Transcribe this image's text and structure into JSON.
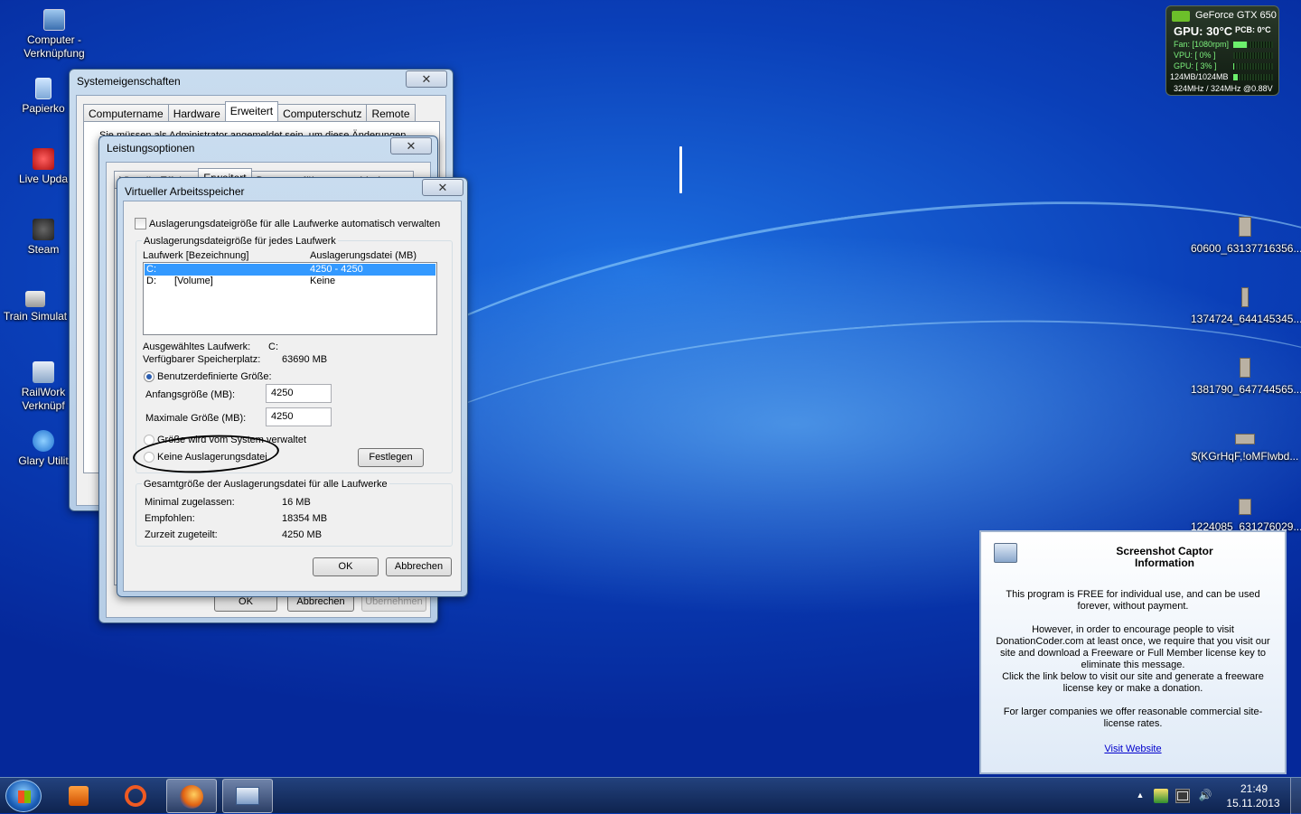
{
  "desktop": {
    "left_icons": [
      {
        "label": "Computer - Verknüpfung"
      },
      {
        "label": "Papierko"
      },
      {
        "label": "Live Upda"
      },
      {
        "label": "Steam"
      },
      {
        "label": "Train Simulat"
      },
      {
        "label": "RailWork Verknüpf"
      },
      {
        "label": "Glary Utilit"
      }
    ],
    "right_icons": [
      {
        "label": "60600_63137716356..."
      },
      {
        "label": "1374724_644145345..."
      },
      {
        "label": "1381790_647744565..."
      },
      {
        "label": "$(KGrHqF,!oMFlwbd..."
      },
      {
        "label": "1224085_631276029..."
      }
    ]
  },
  "gpu_gadget": {
    "title": "GeForce GTX 650",
    "gpu_temp": "GPU: 30°C",
    "pcb_temp": "PCB: 0°C",
    "fan": "Fan: [1080rpm]",
    "vpu": "VPU: [ 0% ]",
    "gpu_load": "GPU: [ 3% ]",
    "memory": "124MB/1024MB",
    "clocks": "324MHz / 324MHz @0.88V",
    "fan_level": 0.35,
    "vpu_level": 0.0,
    "gpu_level": 0.03,
    "mem_level": 0.12
  },
  "sysprops": {
    "title": "Systemeigenschaften",
    "close": "✕",
    "tabs": [
      "Computername",
      "Hardware",
      "Erweitert",
      "Computerschutz",
      "Remote"
    ],
    "selected_tab": "Erweitert",
    "text": "Sie müssen als Administrator angemeldet sein, um diese Änderungen"
  },
  "perfopts": {
    "title": "Leistungsoptionen",
    "close": "✕",
    "tabs": [
      "Visuelle Effekte",
      "Erweitert",
      "Datenausführungsverhinderung"
    ],
    "ok": "OK",
    "cancel": "Abbrechen",
    "apply": "Übernehmen"
  },
  "virtmem": {
    "title": "Virtueller Arbeitsspeicher",
    "close": "✕",
    "auto_manage_label": "Auslagerungsdateigröße für alle Laufwerke automatisch verwalten",
    "auto_manage_checked": false,
    "per_drive_group": "Auslagerungsdateigröße für jedes Laufwerk",
    "col_drive": "Laufwerk [Bezeichnung]",
    "col_pagefile": "Auslagerungsdatei (MB)",
    "drives": [
      {
        "drive": "C:",
        "label": "",
        "pagefile": "4250 - 4250",
        "selected": true
      },
      {
        "drive": "D:",
        "label": "[Volume]",
        "pagefile": "Keine",
        "selected": false
      }
    ],
    "selected_drive_label": "Ausgewähltes Laufwerk:",
    "selected_drive_value": "C:",
    "free_space_label": "Verfügbarer Speicherplatz:",
    "free_space_value": "63690 MB",
    "custom_size_label": "Benutzerdefinierte Größe:",
    "initial_size_label": "Anfangsgröße (MB):",
    "initial_size_value": "4250",
    "max_size_label": "Maximale Größe (MB):",
    "max_size_value": "4250",
    "system_managed_label": "Größe wird vom System verwaltet",
    "no_pagefile_label": "Keine Auslagerungsdatei",
    "set_button": "Festlegen",
    "total_group": "Gesamtgröße der Auslagerungsdatei für alle Laufwerke",
    "min_label": "Minimal zugelassen:",
    "min_value": "16 MB",
    "recommended_label": "Empfohlen:",
    "recommended_value": "18354 MB",
    "allocated_label": "Zurzeit zugeteilt:",
    "allocated_value": "4250 MB",
    "ok": "OK",
    "cancel": "Abbrechen"
  },
  "info_popup": {
    "title": "Screenshot Captor\nInformation",
    "p1": "This program is FREE for individual use, and can be used forever, without payment.",
    "p2": "However, in order to encourage people to visit DonationCoder.com at least once, we require that you visit our site and download a Freeware or Full Member license key to eliminate this message.",
    "p3": "Click the link below to visit our site and generate a freeware license key or make a donation.",
    "p4": "For larger companies we offer reasonable commercial site-license rates.",
    "link": "Visit Website"
  },
  "taskbar": {
    "time": "21:49",
    "date": "15.11.2013",
    "tray_arrow": "▲"
  }
}
